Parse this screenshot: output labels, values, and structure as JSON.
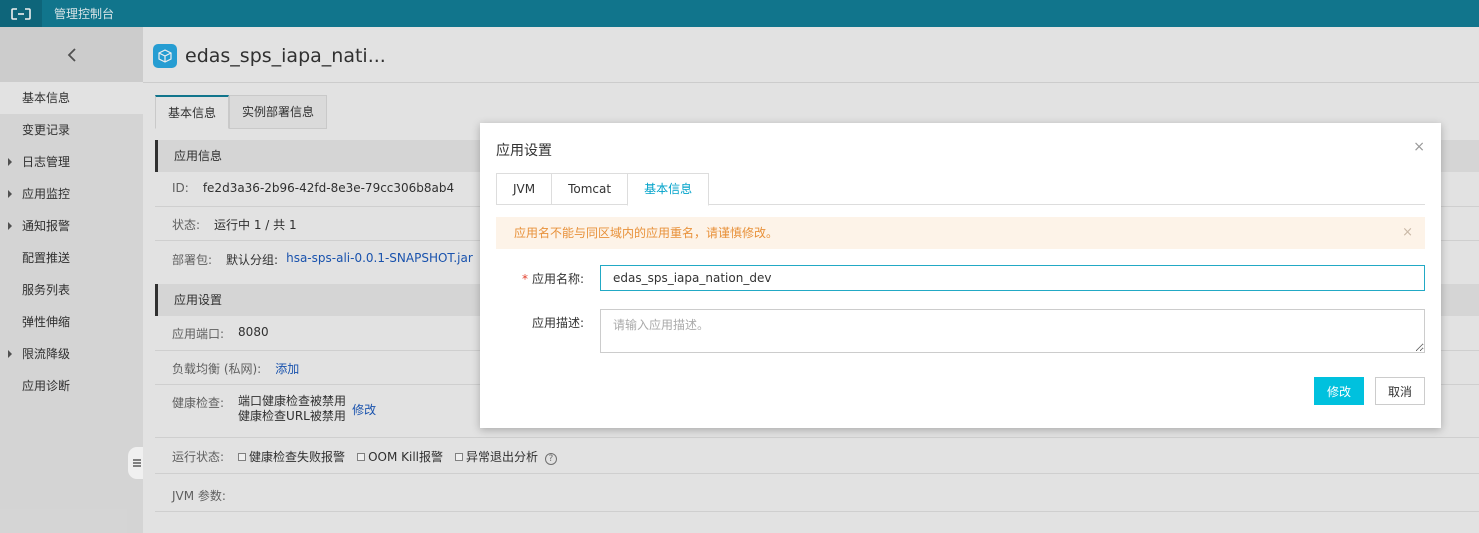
{
  "topbar": {
    "console_label": "管理控制台",
    "logo_icon": "aliyun-logo-icon",
    "bg_color": "#137d95"
  },
  "sidebar": {
    "back_icon": "chevron-left-icon",
    "items": [
      {
        "label": "基本信息",
        "active": true,
        "expandable": false
      },
      {
        "label": "变更记录",
        "active": false,
        "expandable": false
      },
      {
        "label": "日志管理",
        "active": false,
        "expandable": true
      },
      {
        "label": "应用监控",
        "active": false,
        "expandable": true
      },
      {
        "label": "通知报警",
        "active": false,
        "expandable": true
      },
      {
        "label": "配置推送",
        "active": false,
        "expandable": false
      },
      {
        "label": "服务列表",
        "active": false,
        "expandable": false
      },
      {
        "label": "弹性伸缩",
        "active": false,
        "expandable": false
      },
      {
        "label": "限流降级",
        "active": false,
        "expandable": true
      },
      {
        "label": "应用诊断",
        "active": false,
        "expandable": false
      }
    ]
  },
  "page": {
    "title": "edas_sps_iapa_nati...",
    "tabs": [
      {
        "label": "基本信息",
        "active": true
      },
      {
        "label": "实例部署信息",
        "active": false
      }
    ]
  },
  "app_info": {
    "section_title": "应用信息",
    "id_label": "ID:",
    "id_value": "fe2d3a36-2b96-42fd-8e3e-79cc306b8ab4",
    "status_label": "状态:",
    "status_value": "运行中 1 / 共 1",
    "package_label": "部署包:",
    "package_group": "默认分组:",
    "package_link": "hsa-sps-ali-0.0.1-SNAPSHOT.jar"
  },
  "app_settings": {
    "section_title": "应用设置",
    "port_label": "应用端口:",
    "port_value": "8080",
    "lb_label": "负载均衡 (私网):",
    "lb_link": "添加",
    "health_label": "健康检查:",
    "health_line1": "端口健康检查被禁用",
    "health_line2": "健康检查URL被禁用",
    "health_link": "修改",
    "run_label": "运行状态:",
    "run_options": [
      "健康检查失败报警",
      "OOM Kill报警",
      "异常退出分析"
    ],
    "jvm_label": "JVM 参数:"
  },
  "modal": {
    "title": "应用设置",
    "close_glyph": "×",
    "tabs": [
      {
        "label": "JVM",
        "active": false
      },
      {
        "label": "Tomcat",
        "active": false
      },
      {
        "label": "基本信息",
        "active": true
      }
    ],
    "alert_text": "应用名不能与同区域内的应用重名，请谨慎修改。",
    "alert_close": "×",
    "name_label": "应用名称:",
    "name_required_mark": "*",
    "name_value": "edas_sps_iapa_nation_dev",
    "desc_label": "应用描述:",
    "desc_placeholder": "请输入应用描述。",
    "submit_label": "修改",
    "cancel_label": "取消",
    "accent_color": "#00c1de"
  }
}
